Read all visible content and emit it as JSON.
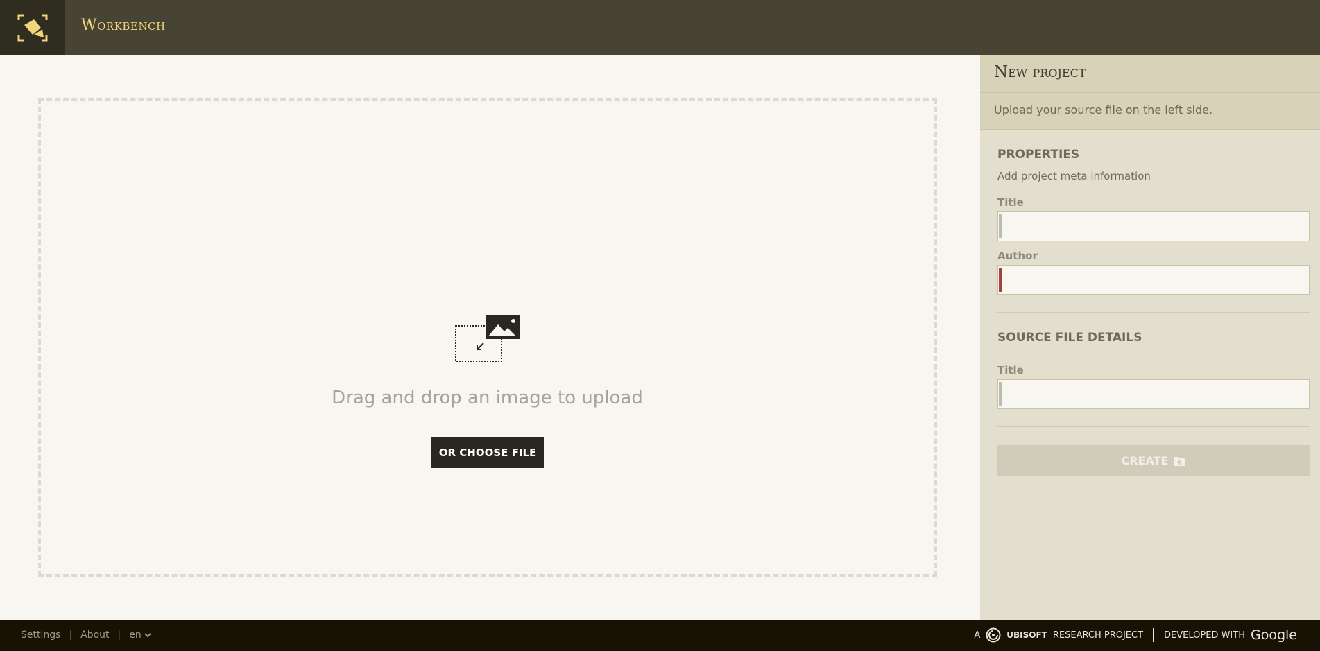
{
  "header": {
    "app_title": "Workbench",
    "logo_icon": "pen-focus-icon",
    "accent_color": "#f0d57a"
  },
  "main": {
    "drop_text": "Drag and drop an image to upload",
    "choose_button": "OR CHOOSE FILE",
    "upload_icon": "image-drop-icon"
  },
  "sidebar": {
    "title": "New project",
    "subtitle": "Upload your source file on the left side.",
    "properties": {
      "heading": "PROPERTIES",
      "description": "Add project meta information",
      "title_label": "Title",
      "title_value": "",
      "author_label": "Author",
      "author_value": ""
    },
    "source": {
      "heading": "SOURCE FILE DETAILS",
      "title_label": "Title",
      "title_value": ""
    },
    "create_button": "CREATE",
    "create_icon": "folder-add-icon"
  },
  "footer": {
    "settings": "Settings",
    "about": "About",
    "language": "en",
    "credit_a": "A",
    "ubisoft": "UBISOFT",
    "research": "RESEARCH PROJECT",
    "developed": "DEVELOPED WITH",
    "google": "Google"
  }
}
